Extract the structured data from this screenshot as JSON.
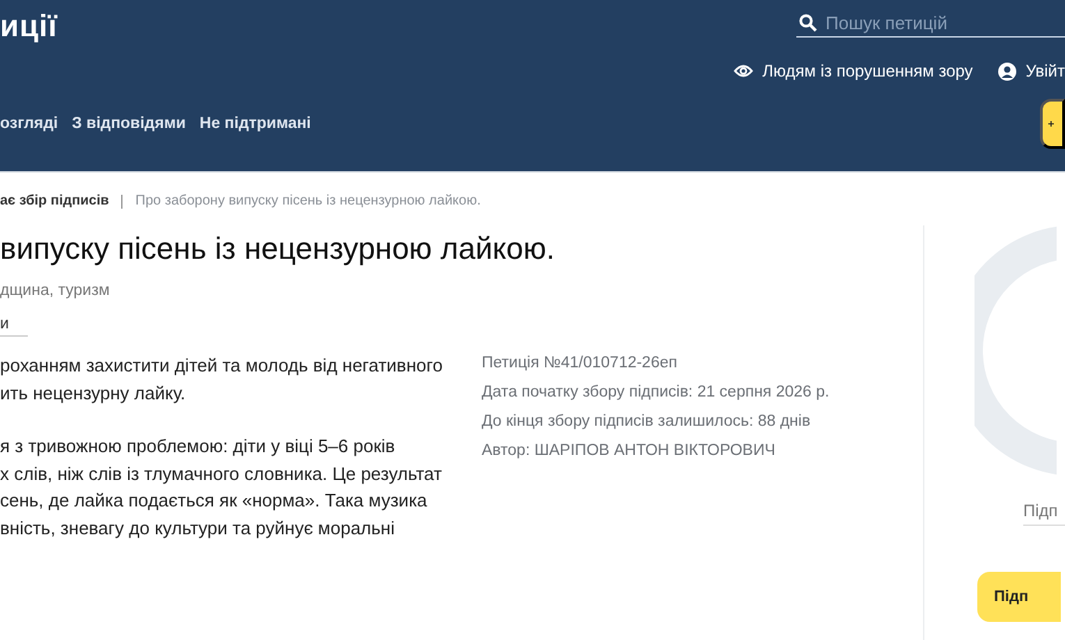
{
  "header": {
    "logo": "иції",
    "search": {
      "placeholder": "Пошук петицій"
    },
    "links": [
      {
        "kind": "eye",
        "label": "Людям із порушенням зору"
      },
      {
        "kind": "user",
        "label": "Увійт"
      }
    ],
    "nav": [
      "озгляді",
      "З відповідями",
      "Не підтримані"
    ]
  },
  "breadcrumb": [
    "ає збір підписів",
    "Про заборону випуску пісень із нецензурною лайкою."
  ],
  "title": "випуску пісень із нецензурною лайкою.",
  "category": "дщина, туризм",
  "tab": "и",
  "body": [
    [
      "роханням захистити дітей та молодь від негативного",
      "ить нецензурну лайку."
    ],
    [
      "я з тривожною проблемою: діти у віці 5–6 років",
      "х слів, ніж слів із тлумачного словника. Це результат",
      "сень, де лайка подається як «норма». Така музика",
      "вність, зневагу до культури та руйнує моральні"
    ]
  ],
  "meta": [
    "Петиція №41/010712-26еп",
    "Дата початку збору підписів: 21 серпня 2026 р.",
    "До кінця збору підписів залишилось: 88 днів",
    "Автор: ШАРІПОВ АНТОН ВІКТОРОВИЧ"
  ],
  "side": {
    "label": "Підп",
    "button": "Підп"
  }
}
